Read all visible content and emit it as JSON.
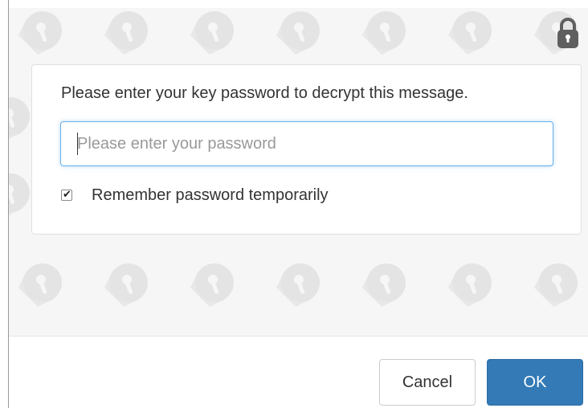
{
  "dialog": {
    "prompt": "Please enter your key password to decrypt this message.",
    "password": {
      "value": "",
      "placeholder": "Please enter your password"
    },
    "remember": {
      "label": "Remember password temporarily",
      "checked": true
    }
  },
  "footer": {
    "cancel_label": "Cancel",
    "ok_label": "OK"
  },
  "icons": {
    "header": "lock-icon",
    "background": "lock-pattern"
  },
  "colors": {
    "primary": "#337ab7",
    "focus_border": "#66afe9",
    "pattern_bg": "#f6f6f6",
    "pattern_lock": "#e6e6e6"
  }
}
